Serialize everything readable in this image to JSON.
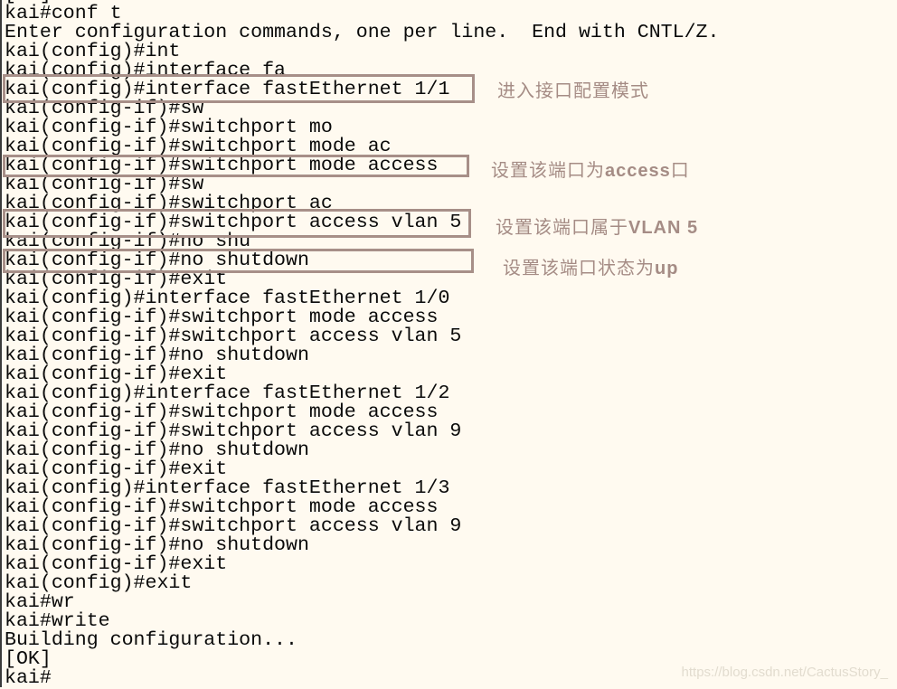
{
  "terminal": {
    "lines": [
      "[OK]",
      "kai#conf t",
      "Enter configuration commands, one per line.  End with CNTL/Z.",
      "kai(config)#int",
      "kai(config)#interface fa",
      "kai(config)#interface fastEthernet 1/1",
      "kai(config-if)#sw",
      "kai(config-if)#switchport mo",
      "kai(config-if)#switchport mode ac",
      "kai(config-if)#switchport mode access",
      "kai(config-if)#sw",
      "kai(config-if)#switchport ac",
      "kai(config-if)#switchport access vlan 5",
      "kai(config-if)#no shu",
      "kai(config-if)#no shutdown",
      "kai(config-if)#exit",
      "kai(config)#interface fastEthernet 1/0",
      "kai(config-if)#switchport mode access",
      "kai(config-if)#switchport access vlan 5",
      "kai(config-if)#no shutdown",
      "kai(config-if)#exit",
      "kai(config)#interface fastEthernet 1/2",
      "kai(config-if)#switchport mode access",
      "kai(config-if)#switchport access vlan 9",
      "kai(config-if)#no shutdown",
      "kai(config-if)#exit",
      "kai(config)#interface fastEthernet 1/3",
      "kai(config-if)#switchport mode access",
      "kai(config-if)#switchport access vlan 9",
      "kai(config-if)#no shutdown",
      "kai(config-if)#exit",
      "kai(config)#exit",
      "kai#wr",
      "kai#write",
      "Building configuration...",
      "[OK]",
      "kai#"
    ]
  },
  "annotations": [
    {
      "target_line": "kai(config)#interface fastEthernet 1/1",
      "note": "进入接口配置模式"
    },
    {
      "target_line": "kai(config-if)#switchport mode access",
      "note_cn": "设置该端口为",
      "note_en": "access",
      "note_tail": "口"
    },
    {
      "target_line": "kai(config-if)#switchport access vlan 5",
      "note_cn": "设置该端口属于",
      "note_en": "VLAN 5"
    },
    {
      "target_line": "kai(config-if)#no shutdown",
      "note_cn": "设置该端口状态为",
      "note_en": "up"
    }
  ],
  "watermark": "https://blog.csdn.net/CactusStory_",
  "colors": {
    "background": "#fffaf0",
    "text": "#0a0a0a",
    "highlight_border": "#a78f88",
    "note_text": "#a58c85",
    "watermark": "#e2dccf"
  }
}
